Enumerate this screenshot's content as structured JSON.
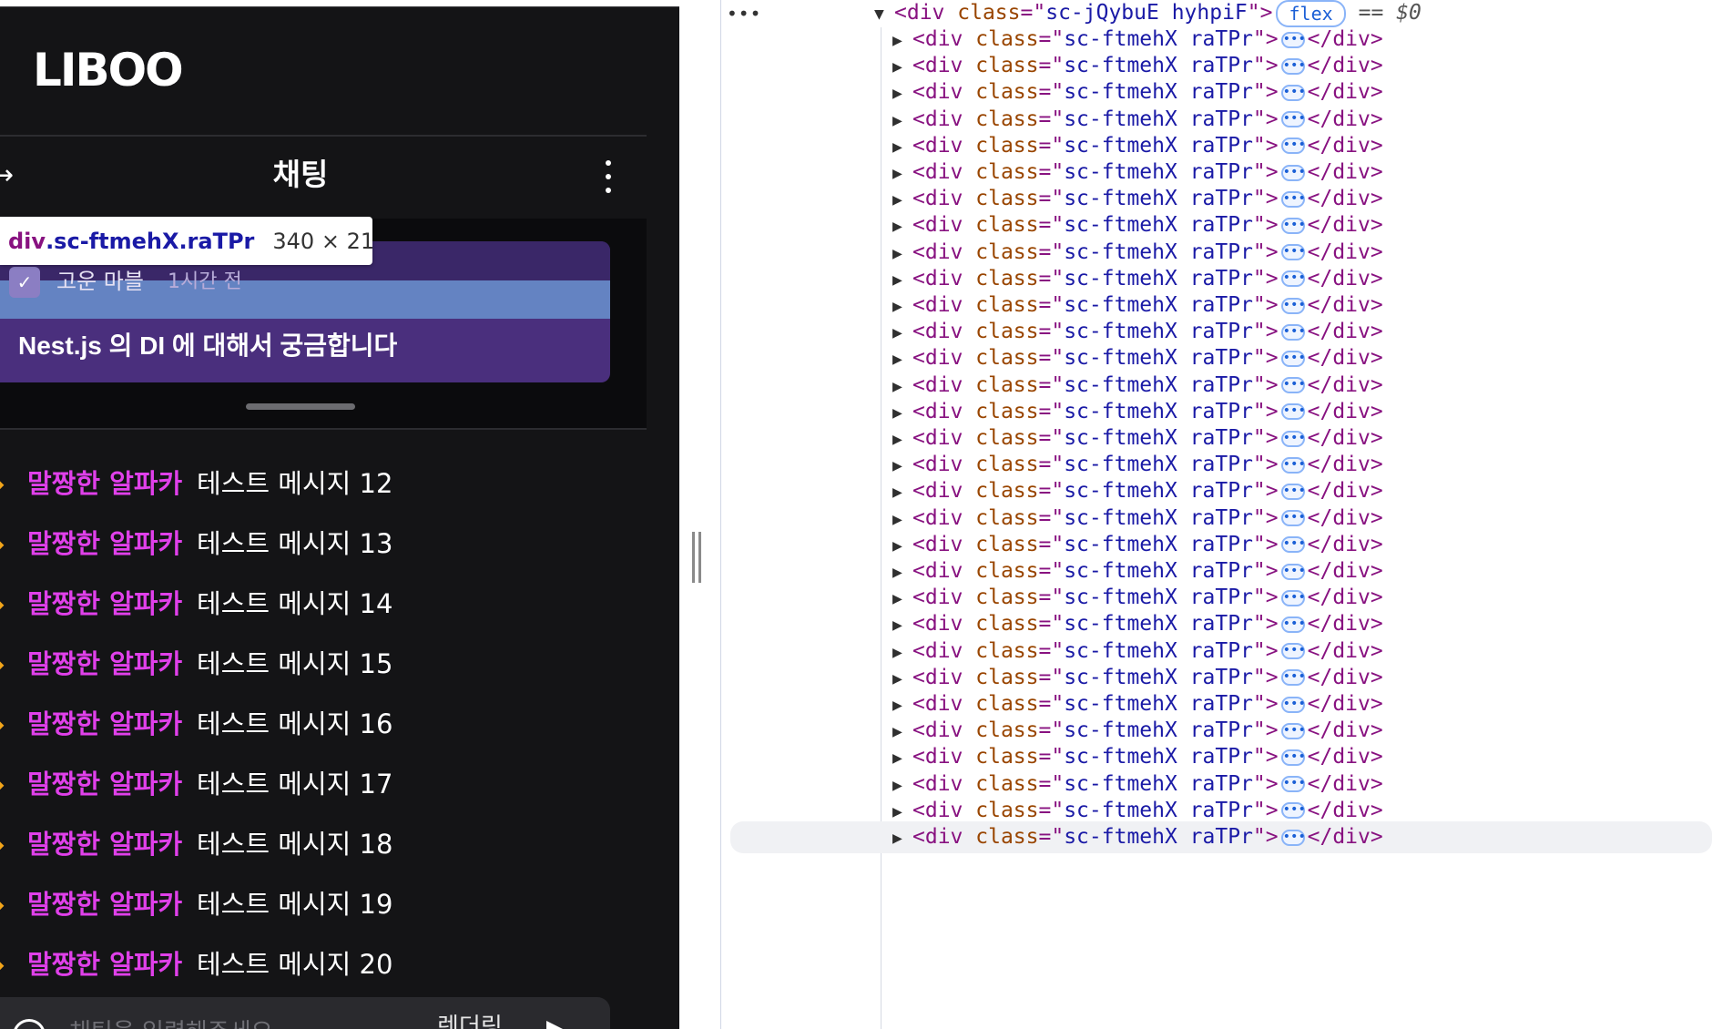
{
  "app": {
    "logo": "LIBOO",
    "header": {
      "back_icon": "→",
      "title": "채팅"
    },
    "pinned": {
      "author": "고운 마블",
      "time": "1시간 전",
      "message": "Nest.js 의 DI 에 대해서 궁금합니다"
    },
    "tooltip": {
      "tag": "div",
      "class_name": ".sc-ftmehX.raTPr",
      "dimensions": "340 × 21"
    },
    "messages": [
      {
        "nick": "말짱한 알파카",
        "text": "테스트 메시지 12"
      },
      {
        "nick": "말짱한 알파카",
        "text": "테스트 메시지 13"
      },
      {
        "nick": "말짱한 알파카",
        "text": "테스트 메시지 14"
      },
      {
        "nick": "말짱한 알파카",
        "text": "테스트 메시지 15"
      },
      {
        "nick": "말짱한 알파카",
        "text": "테스트 메시지 16"
      },
      {
        "nick": "말짱한 알파카",
        "text": "테스트 메시지 17"
      },
      {
        "nick": "말짱한 알파카",
        "text": "테스트 메시지 18"
      },
      {
        "nick": "말짱한 알파카",
        "text": "테스트 메시지 19"
      },
      {
        "nick": "말짱한 알파카",
        "text": "테스트 메시지 20"
      }
    ],
    "input": {
      "placeholder": "채팅을 입력해주세요",
      "render_label": "렌더링"
    }
  },
  "devtools": {
    "more_label": "•••",
    "parent": {
      "tag": "div",
      "attr": "class",
      "value": "sc-jQybuE hyhpiF",
      "badge": "flex",
      "selected_marker": "== $0"
    },
    "child": {
      "open": "<div",
      "attr": "class",
      "value": "sc-ftmehX raTPr",
      "close": "</div>",
      "ellipsis": "•••"
    },
    "child_count": 31
  }
}
